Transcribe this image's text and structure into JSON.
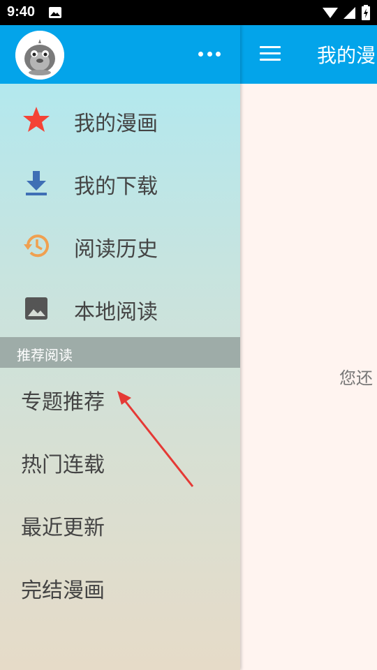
{
  "status_bar": {
    "time": "9:40"
  },
  "main": {
    "title": "我的漫",
    "empty_text": "您还"
  },
  "drawer": {
    "nav_items": [
      {
        "label": "我的漫画",
        "icon": "star-icon"
      },
      {
        "label": "我的下载",
        "icon": "download-icon"
      },
      {
        "label": "阅读历史",
        "icon": "history-icon"
      },
      {
        "label": "本地阅读",
        "icon": "image-icon"
      }
    ],
    "section_title": "推荐阅读",
    "recommend_items": [
      {
        "label": "专题推荐"
      },
      {
        "label": "热门连载"
      },
      {
        "label": "最近更新"
      },
      {
        "label": "完结漫画"
      }
    ]
  },
  "colors": {
    "appbar": "#03A4EA",
    "star": "#F44336",
    "download": "#3F6FB5",
    "history": "#F0A050",
    "image": "#555555",
    "annotation_arrow": "#E53935"
  }
}
